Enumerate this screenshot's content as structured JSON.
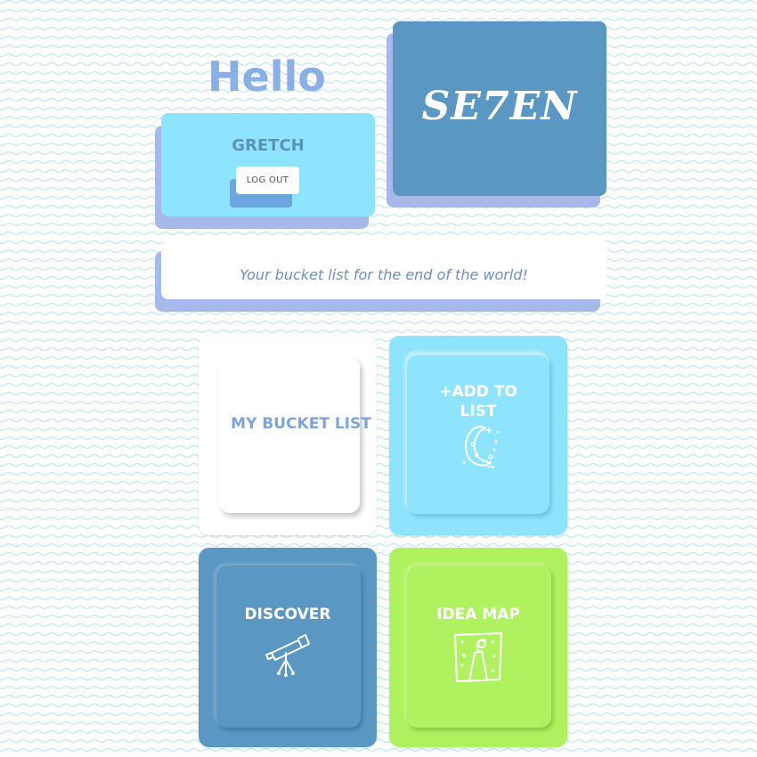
{
  "header": {
    "greeting": "Hello"
  },
  "user": {
    "name": "GRETCH",
    "logout_label": "LOG OUT"
  },
  "logo": {
    "text": "SE7EN"
  },
  "tagline": "Your bucket list for the end of the world!",
  "tiles": [
    {
      "label": "MY BUCKET LIST",
      "icon": "none"
    },
    {
      "label": "+ADD TO LIST",
      "icon": "moon-icon"
    },
    {
      "label": "DISCOVER",
      "icon": "telescope-icon"
    },
    {
      "label": "IDEA MAP",
      "icon": "map-icon"
    }
  ],
  "colors": {
    "background_wave": "#bfe7f7",
    "greeting": "#8aaee6",
    "card_shadow": "#a7b9ea",
    "light_blue": "#8ee4fc",
    "mid_blue": "#5a97c3",
    "lime": "#b0f15f",
    "white": "#ffffff",
    "label_blue": "#7fa3de"
  }
}
